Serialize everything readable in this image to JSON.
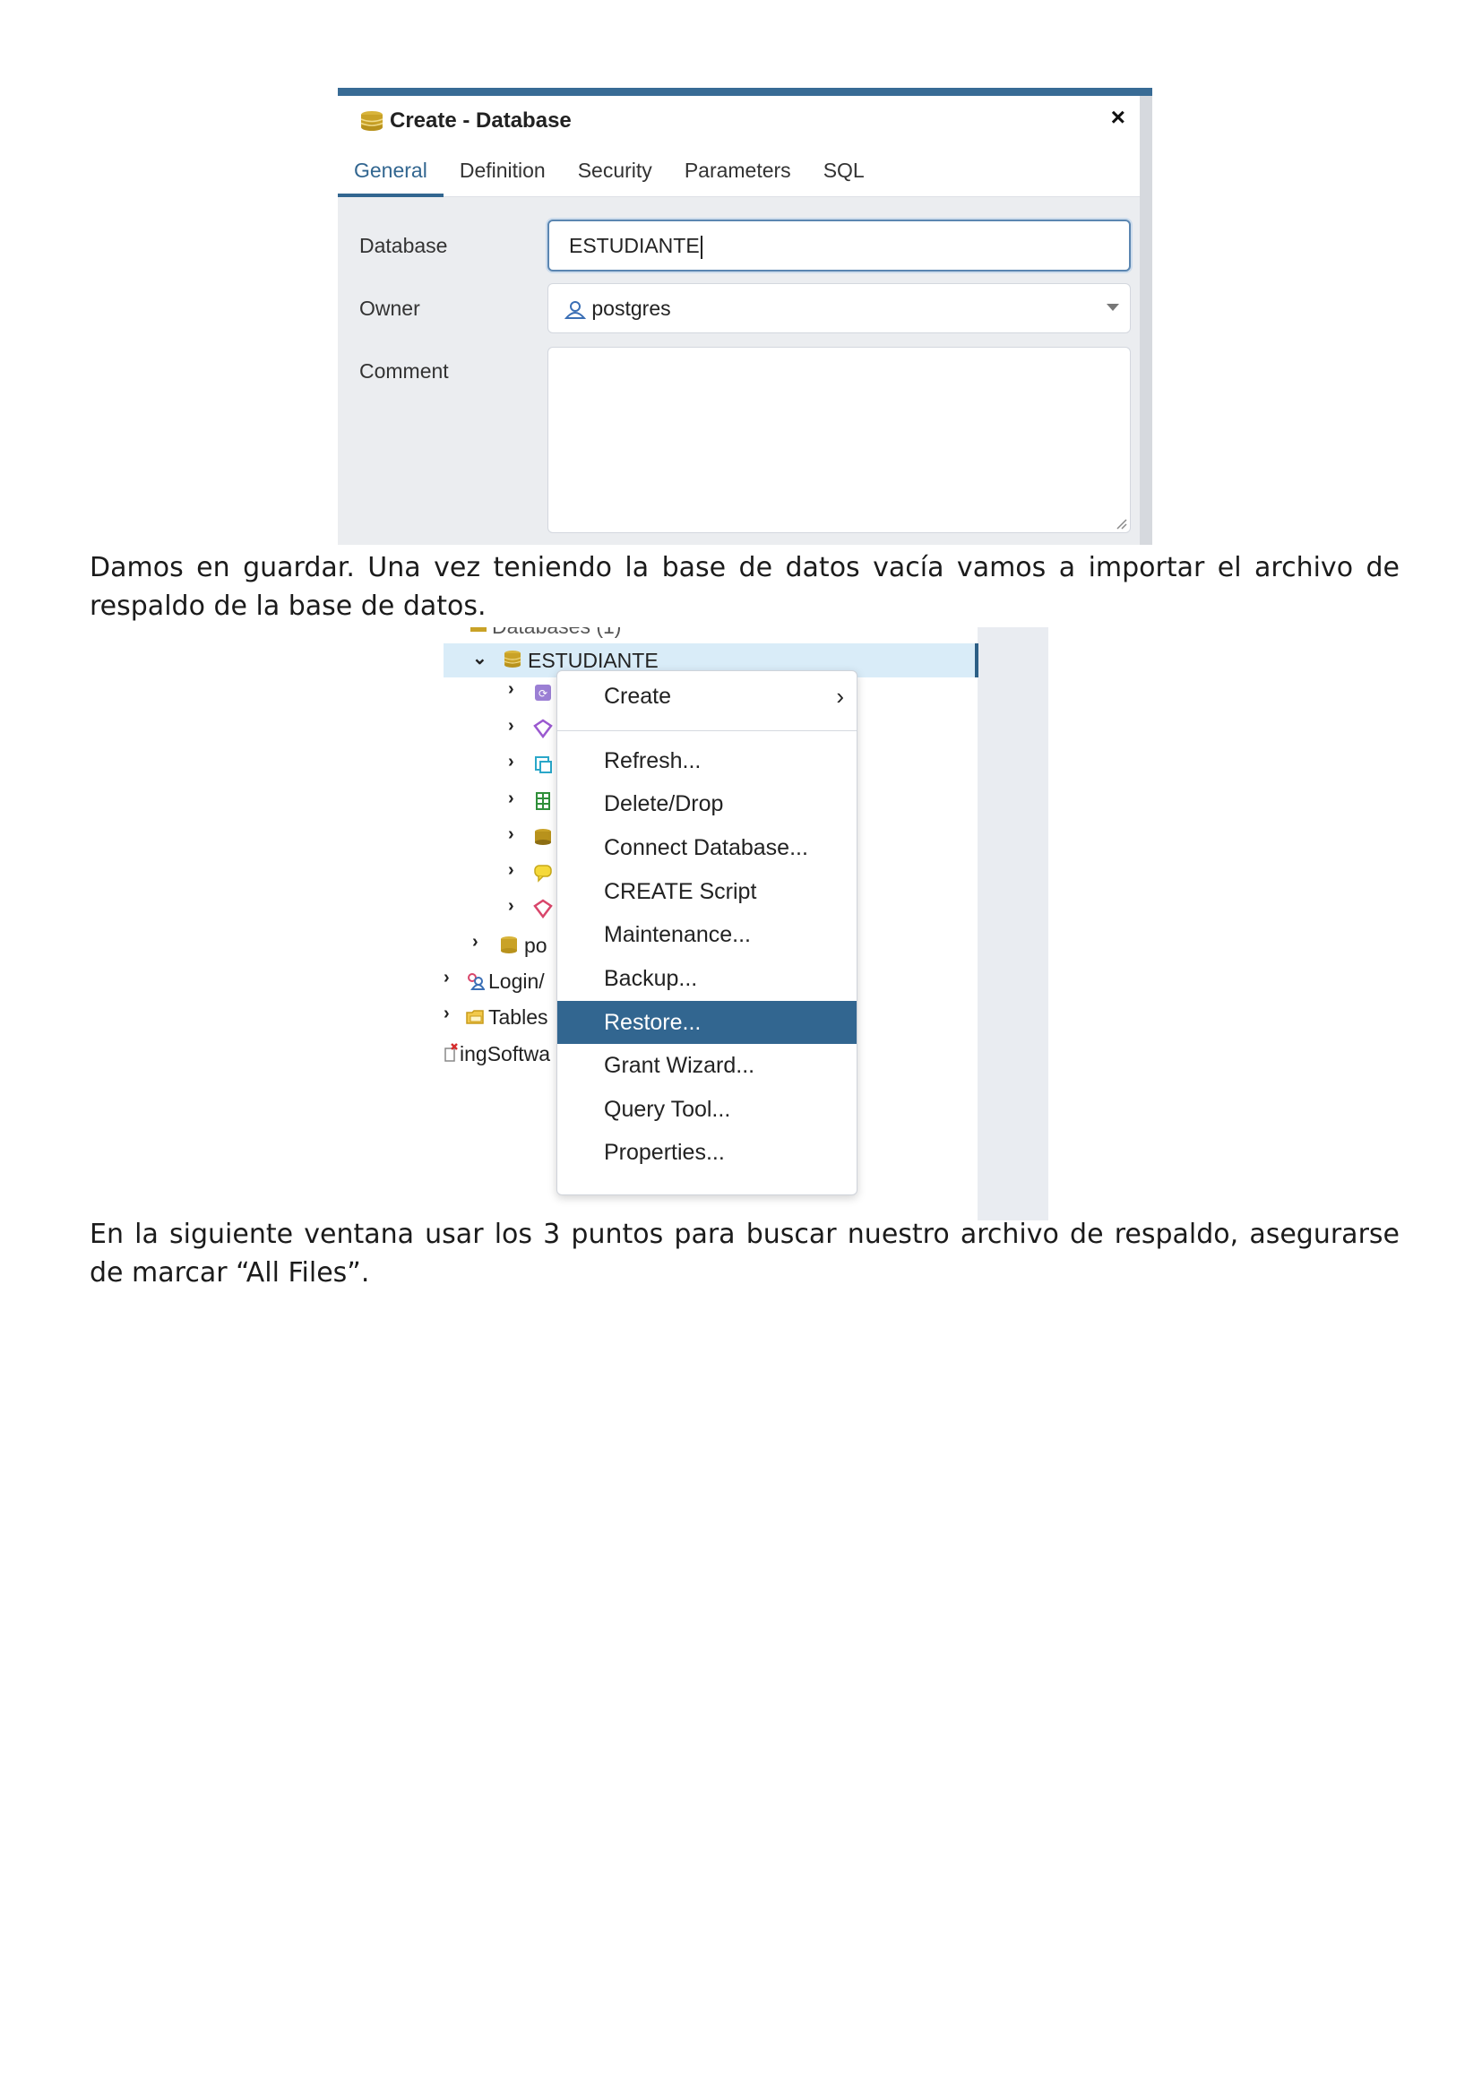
{
  "dialog": {
    "title": "Create - Database",
    "close_glyph": "×",
    "tabs": [
      "General",
      "Definition",
      "Security",
      "Parameters",
      "SQL"
    ],
    "active_tab": "General",
    "fields": {
      "database_label": "Database",
      "database_value": "ESTUDIANTE",
      "owner_label": "Owner",
      "owner_value": "postgres",
      "comment_label": "Comment",
      "comment_value": ""
    },
    "icons": {
      "title": "database-icon",
      "owner": "user-icon"
    }
  },
  "paragraphs": {
    "p1": "Damos en guardar. Una vez teniendo la base de datos vacía vamos a importar el archivo de respaldo de la base de datos.",
    "p2": "En la siguiente ventana usar los 3 puntos para buscar nuestro archivo de respaldo, asegurarse de marcar “All Files”."
  },
  "tree": {
    "top_partial": "Databases (1)",
    "selected_node": "ESTUDIANTE",
    "child_icons": [
      "cast-icon",
      "extension-icon",
      "foreign-data-wrapper-icon",
      "language-icon",
      "publication-icon",
      "schema-icon",
      "subscription-icon"
    ],
    "sibling_partial": "po",
    "login_partial": "Login/",
    "tablespaces_partial": "Tables",
    "server_partial": "ingSoftwa"
  },
  "context_menu": {
    "items": [
      {
        "label": "Create",
        "submenu": true
      },
      {
        "label": "Refresh..."
      },
      {
        "label": "Delete/Drop"
      },
      {
        "label": "Connect Database..."
      },
      {
        "label": "CREATE Script"
      },
      {
        "label": "Maintenance..."
      },
      {
        "label": "Backup..."
      },
      {
        "label": "Restore...",
        "highlighted": true
      },
      {
        "label": "Grant Wizard..."
      },
      {
        "label": "Query Tool..."
      },
      {
        "label": "Properties..."
      }
    ],
    "submenu_glyph": "›"
  },
  "colors": {
    "accent": "#326690",
    "highlight_bg": "#326690",
    "selected_row_bg": "#d9ecf8",
    "database_icon": "#c9a227"
  }
}
